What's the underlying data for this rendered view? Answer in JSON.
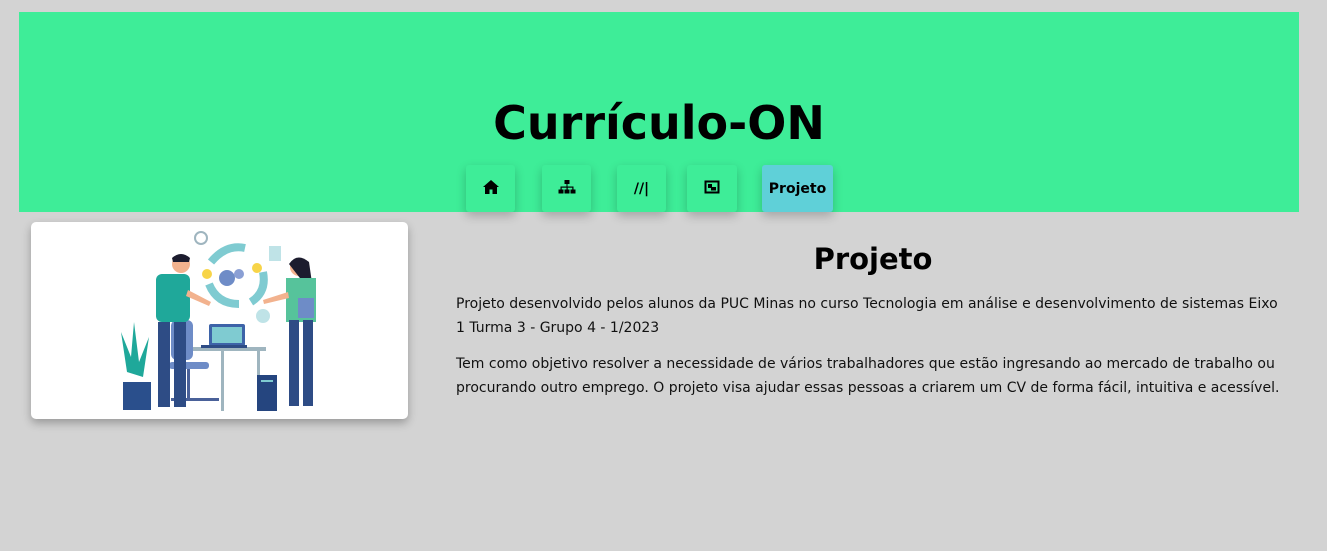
{
  "header": {
    "title": "Currículo-ON",
    "background": "#3eed98"
  },
  "nav": {
    "items": [
      {
        "icon": "home-icon",
        "label": ""
      },
      {
        "icon": "sitemap-icon",
        "label": ""
      },
      {
        "icon": "slashes-icon",
        "label": "//|"
      },
      {
        "icon": "portrait-icon",
        "label": ""
      },
      {
        "icon": "",
        "label": "Projeto"
      }
    ],
    "active_color": "#5fd0d8"
  },
  "main": {
    "image_alt": "team-collaboration-illustration",
    "title": "Projeto",
    "paragraphs": [
      "Projeto desenvolvido pelos alunos da PUC Minas no curso Tecnologia em análise e desenvolvimento de sistemas Eixo 1 Turma 3 - Grupo 4 - 1/2023",
      "Tem como objetivo resolver a necessidade de vários trabalhadores que estão ingresando ao mercado de trabalho ou procurando outro emprego. O projeto visa ajudar essas pessoas a criarem um CV de forma fácil, intuitiva e acessível."
    ]
  },
  "colors": {
    "page_background": "#d3d3d3",
    "accent": "#3eed98",
    "active_tab": "#5fd0d8"
  }
}
